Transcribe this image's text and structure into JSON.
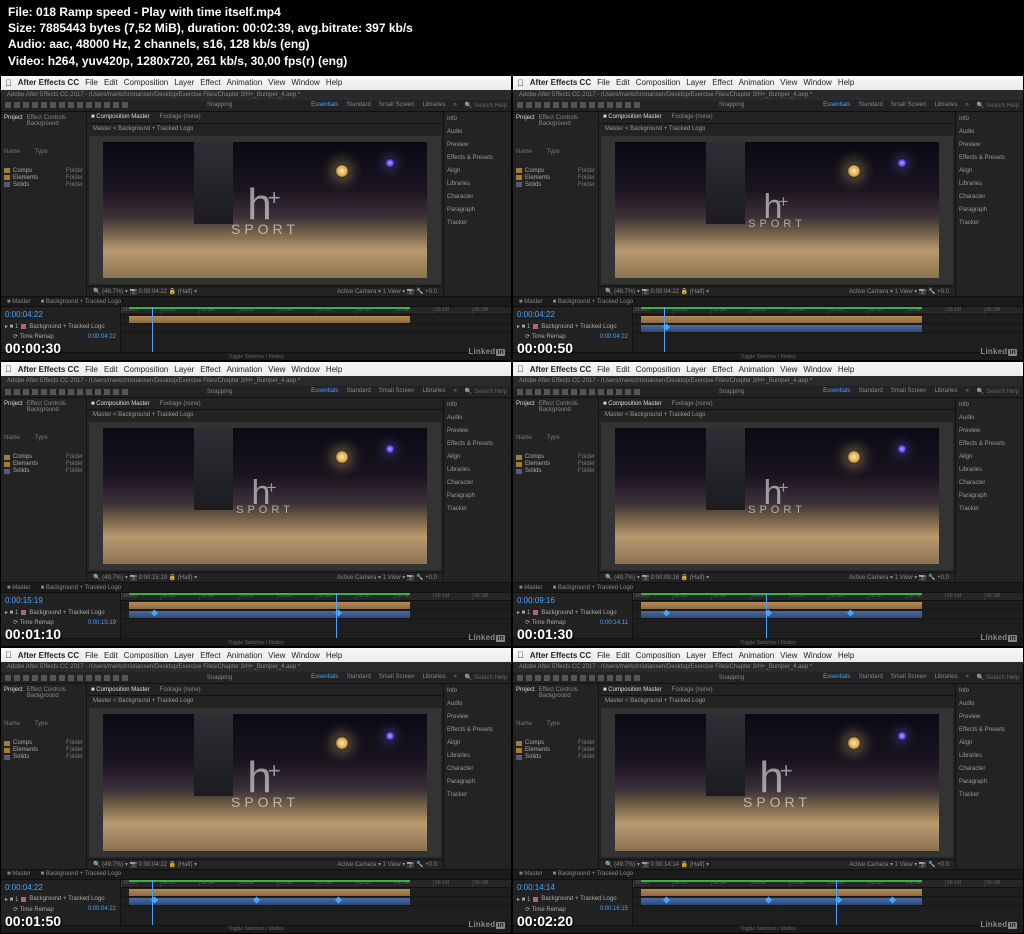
{
  "meta": {
    "l_file": "File:",
    "file": "018 Ramp speed - Play with time itself.mp4",
    "l_size": "Size:",
    "size": "7885443 bytes (7,52 MiB), duration: 00:02:39, avg.bitrate: 397 kb/s",
    "l_audio": "Audio:",
    "audio": "aac, 48000 Hz, 2 channels, s16, 128 kb/s (eng)",
    "l_video": "Video:",
    "video": "h264, yuv420p, 1280x720, 261 kb/s, 30,00 fps(r) (eng)"
  },
  "menubar": {
    "app": "After Effects CC",
    "items": [
      "File",
      "Edit",
      "Composition",
      "Layer",
      "Effect",
      "Animation",
      "View",
      "Window",
      "Help"
    ]
  },
  "app_title": "Adobe After Effects CC 2017 - /Users/markchristiansen/Desktop/Exercise Files/Chapter 3/H+_Bumper_4.aep *",
  "workspace_tabs": {
    "snapping": "Snapping",
    "essentials": "Essentials",
    "standard": "Standard",
    "small": "Small Screen",
    "libraries": "Libraries",
    "search": "Search Help"
  },
  "left_panel": {
    "tab_project": "Project",
    "tab_effect": "Effect Controls Background",
    "items": [
      {
        "label": "Comps",
        "type": "folder"
      },
      {
        "label": "Elements",
        "type": "folder"
      },
      {
        "label": "Solids",
        "type": "solid"
      }
    ],
    "col_name": "Name",
    "col_type": "Type",
    "type_folder": "Folder",
    "type_solid": "Folder"
  },
  "center": {
    "tab_comp": "Composition Master",
    "tab_footage": "Footage (none)",
    "breadcrumb": "Master  <  Background + Tracked Logo",
    "logo_h": "h",
    "logo_plus": "+",
    "logo_sport": "SPORT",
    "status_left": "(49.7%)",
    "status_tc": "0:00:04:22",
    "status_half": "(Half)",
    "status_cam": "Active Camera",
    "status_view": "1 View",
    "status_right": "+0.0"
  },
  "right_panel": {
    "items": [
      "Info",
      "Audio",
      "Preview",
      "Effects & Presets",
      "Align",
      "Libraries",
      "Character",
      "Paragraph",
      "Tracker"
    ]
  },
  "timeline": {
    "tab_master": "Master",
    "tab_bg": "Background + Tracked Logo",
    "layer1": "Background + Tracked Logo",
    "layer2": "Time Remap",
    "footer": "Toggle Switches / Modes",
    "ruler": [
      "00:00f",
      "00:02f",
      "00:04f",
      "00:06f",
      "00:08f",
      "00:10f",
      "00:12f",
      "00:14f",
      "00:16f",
      "00:18f"
    ]
  },
  "thumbs": [
    {
      "ts": "00:00:30",
      "timecode": "0:00:04:22",
      "subtc": "0:00:04:22",
      "playhead": "8%",
      "logo_size": "big",
      "show_remap_bar": false,
      "kf": []
    },
    {
      "ts": "00:00:50",
      "timecode": "0:00:04:22",
      "subtc": "0:00:04:22",
      "playhead": "8%",
      "logo_size": "small",
      "show_remap_bar": true,
      "kf": [
        "8%"
      ]
    },
    {
      "ts": "00:01:10",
      "timecode": "0:00:15:19",
      "subtc": "0:00:15:19",
      "playhead": "55%",
      "logo_size": "small",
      "show_remap_bar": true,
      "kf": [
        "8%",
        "55%"
      ]
    },
    {
      "ts": "00:01:30",
      "timecode": "0:00:09:16",
      "subtc": "0:00:14:11",
      "playhead": "34%",
      "logo_size": "small",
      "show_remap_bar": true,
      "kf": [
        "8%",
        "34%",
        "55%"
      ]
    },
    {
      "ts": "00:01:50",
      "timecode": "0:00:04:22",
      "subtc": "0:00:04:22",
      "playhead": "8%",
      "logo_size": "big",
      "show_remap_bar": true,
      "kf": [
        "8%",
        "34%",
        "55%"
      ]
    },
    {
      "ts": "00:02:20",
      "timecode": "0:00:14:14",
      "subtc": "0:00:16:15",
      "playhead": "52%",
      "logo_size": "big",
      "show_remap_bar": true,
      "kf": [
        "8%",
        "34%",
        "52%",
        "66%"
      ]
    }
  ],
  "brand": {
    "linked": "Linked",
    "in": "in"
  }
}
